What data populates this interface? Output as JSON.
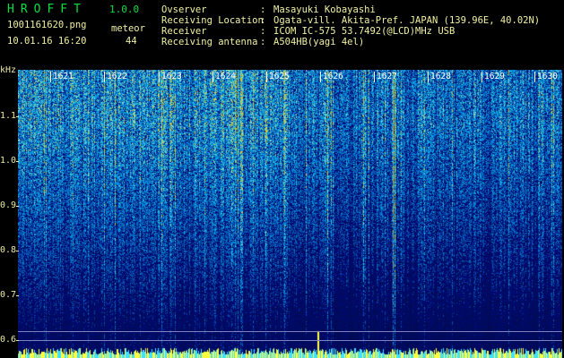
{
  "app": {
    "name": "HROFFT",
    "version": "1.0.0"
  },
  "file": {
    "name": "1001161620.png",
    "datetime": "10.01.16 16:20"
  },
  "meteor": {
    "label": "meteor",
    "count": "44"
  },
  "info": [
    {
      "label": "Ovserver",
      "sep": ":",
      "value": "Masayuki Kobayashi"
    },
    {
      "label": "Receiving Location",
      "sep": ":",
      "value": "Ogata-vill. Akita-Pref. JAPAN (139.96E, 40.02N)"
    },
    {
      "label": "Receiver",
      "sep": ":",
      "value": "ICOM IC-575 53.7492(@LCD)MHz USB"
    },
    {
      "label": "Receiving antenna",
      "sep": ":",
      "value": "A504HB(yagi 4el)"
    }
  ],
  "axis": {
    "unit": "kHz",
    "y_ticks": [
      "1.1",
      "1.0",
      "0.9",
      "0.8",
      "0.7",
      "0.6"
    ],
    "minute_labels": [
      "1621",
      "1622",
      "1623",
      "1624",
      "1625",
      "1626",
      "1627",
      "1628",
      "1629",
      "1630"
    ]
  },
  "colors": {
    "title": "#00e040",
    "text": "#f0f0a0",
    "background": "#000000",
    "noise_low": "#0a1a70",
    "noise_high": "#40c0ff",
    "meteor": "#ffff40"
  }
}
